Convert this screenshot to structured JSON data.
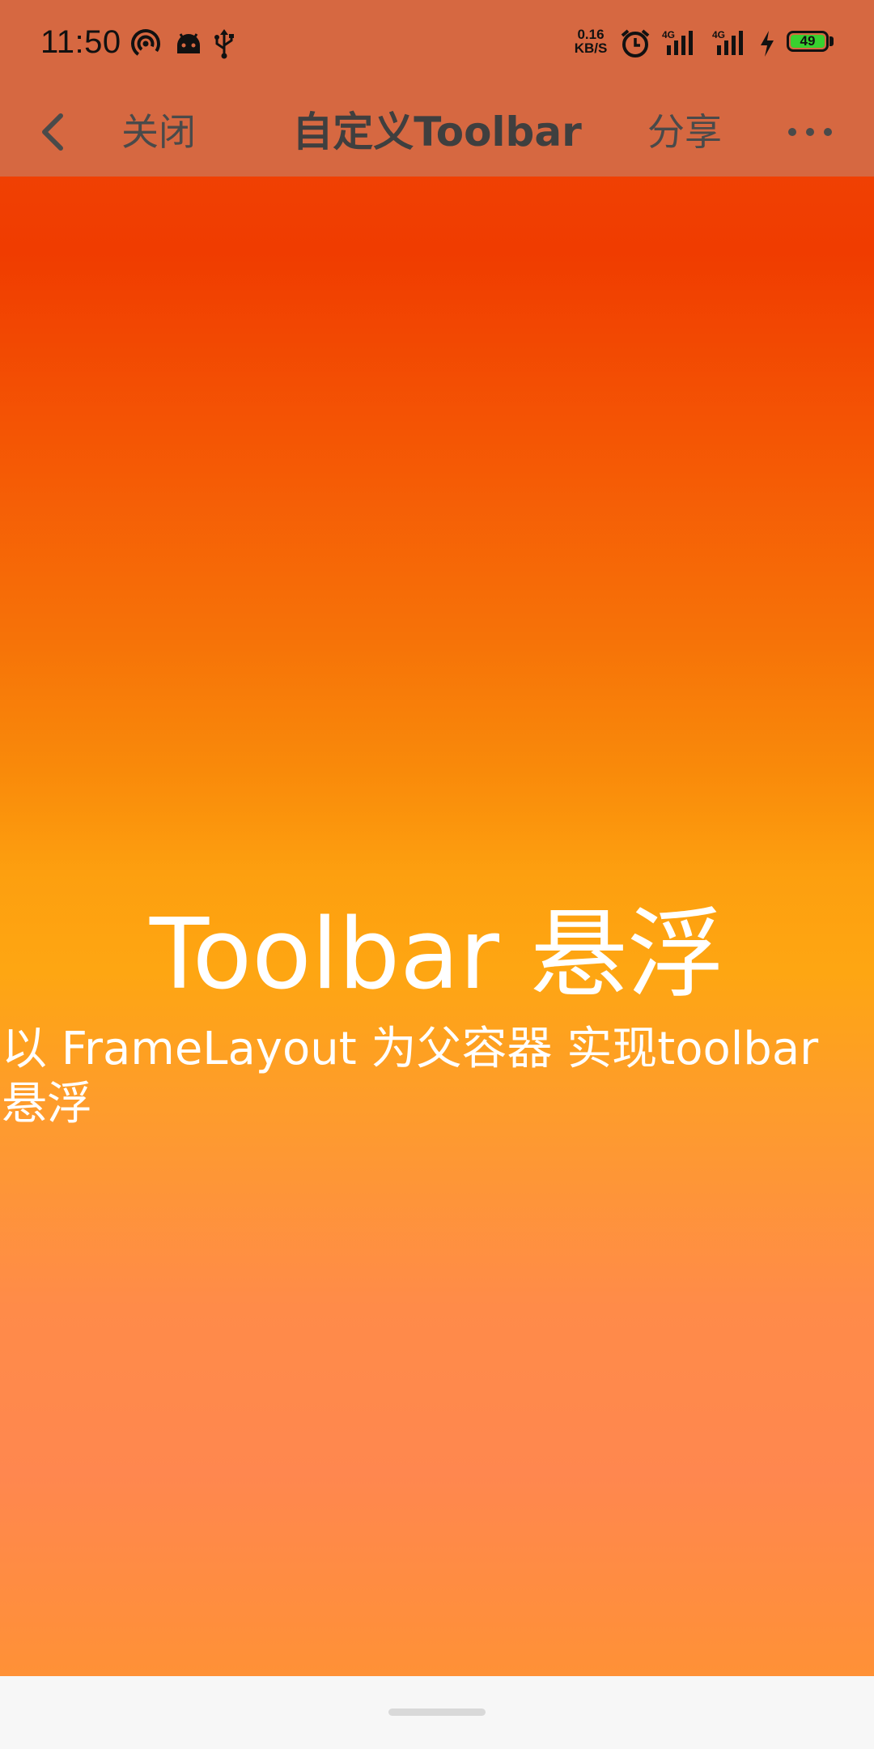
{
  "status_bar": {
    "time": "11:50",
    "net_speed_value": "0.16",
    "net_speed_unit": "KB/S",
    "signal1_label": "4G",
    "signal2_label": "4G",
    "battery_level": "49",
    "icons": [
      "hotspot-icon",
      "android-icon",
      "usb-icon",
      "alarm-icon",
      "signal-icon",
      "charging-icon",
      "battery-icon"
    ]
  },
  "toolbar": {
    "back_icon": "chevron-left-icon",
    "close_label": "关闭",
    "title": "自定义Toolbar",
    "share_label": "分享",
    "more_icon": "more-horizontal-icon",
    "background_color": "#d66841",
    "text_color": "#4a4a4a"
  },
  "content": {
    "headline": "Toolbar 悬浮",
    "subline": "以 FrameLayout 为父容器 实现toolbar 悬浮",
    "gradient_colors": [
      "#f03c00",
      "#f67208",
      "#fea612",
      "#ff874f"
    ]
  },
  "navigation": {
    "home_indicator": "gesture-bar"
  }
}
